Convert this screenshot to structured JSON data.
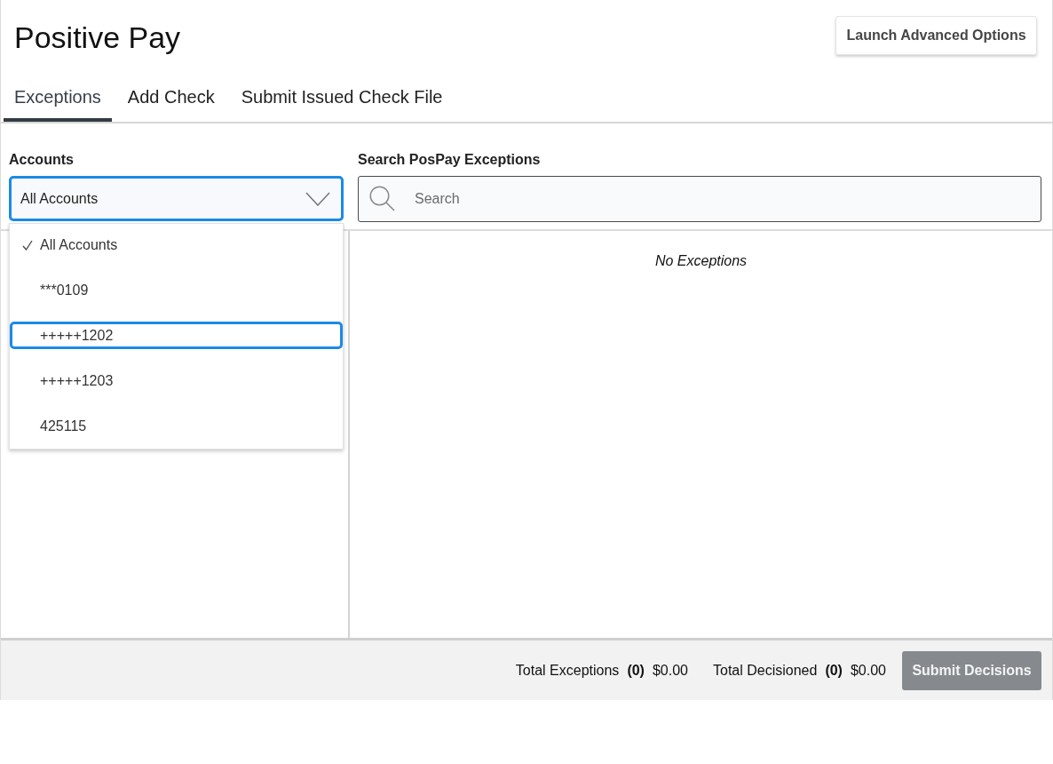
{
  "page": {
    "title": "Positive Pay",
    "action_button": {
      "label": "Launch Advanced Options"
    }
  },
  "tabs": [
    {
      "label": "Exceptions",
      "selected": true
    },
    {
      "label": "Add Check",
      "selected": false
    },
    {
      "label": "Submit Issued Check File",
      "selected": false
    }
  ],
  "accounts": {
    "label": "Accounts",
    "value": "All Accounts",
    "expanded": true,
    "options": [
      {
        "label": "All Accounts",
        "selected": true,
        "focused": false
      },
      {
        "label": "***0109",
        "selected": false,
        "focused": false
      },
      {
        "label": "+++++1202",
        "selected": false,
        "focused": true
      },
      {
        "label": "+++++1203",
        "selected": false,
        "focused": false
      },
      {
        "label": "425115",
        "selected": false,
        "focused": false
      }
    ]
  },
  "search": {
    "label": "Search PosPay Exceptions",
    "placeholder": "Search"
  },
  "results": {
    "empty_message": "No Exceptions"
  },
  "footer": {
    "totals": [
      {
        "label": "Total Exceptions",
        "count": "(0)",
        "amount": "$0.00"
      },
      {
        "label": "Total Decisioned",
        "count": "(0)",
        "amount": "$0.00"
      }
    ],
    "submit_button": {
      "label": "Submit Decisions",
      "disabled": true
    }
  }
}
